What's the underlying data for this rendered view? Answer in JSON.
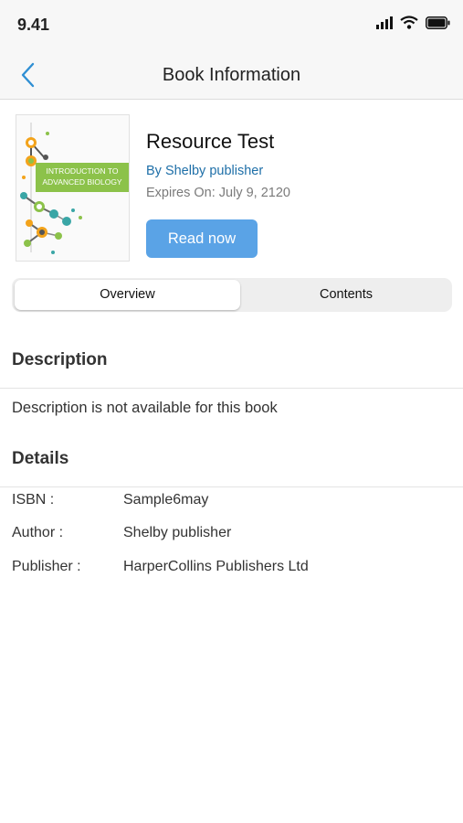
{
  "status_bar": {
    "time": "9.41",
    "icons": [
      "signal-icon",
      "wifi-icon",
      "battery-icon"
    ]
  },
  "nav": {
    "title": "Book Information",
    "back_icon": "chevron-left-icon",
    "accent_color": "#2f8fd3"
  },
  "book": {
    "cover_title": "INTRODUCTION TO ADVANCED BIOLOGY",
    "title": "Resource Test",
    "author_line": "By Shelby publisher",
    "expiry": "Expires On: July 9, 2120",
    "read_label": "Read now",
    "read_button_color": "#5aa3e6"
  },
  "tabs": [
    {
      "label": "Overview",
      "active": true
    },
    {
      "label": "Contents",
      "active": false
    }
  ],
  "description": {
    "heading": "Description",
    "text": "Description is not available for this book"
  },
  "details": {
    "heading": "Details",
    "rows": [
      {
        "label": "ISBN :",
        "value": "Sample6may"
      },
      {
        "label": "Author :",
        "value": "Shelby publisher"
      },
      {
        "label": "Publisher :",
        "value": "HarperCollins Publishers Ltd"
      }
    ]
  }
}
